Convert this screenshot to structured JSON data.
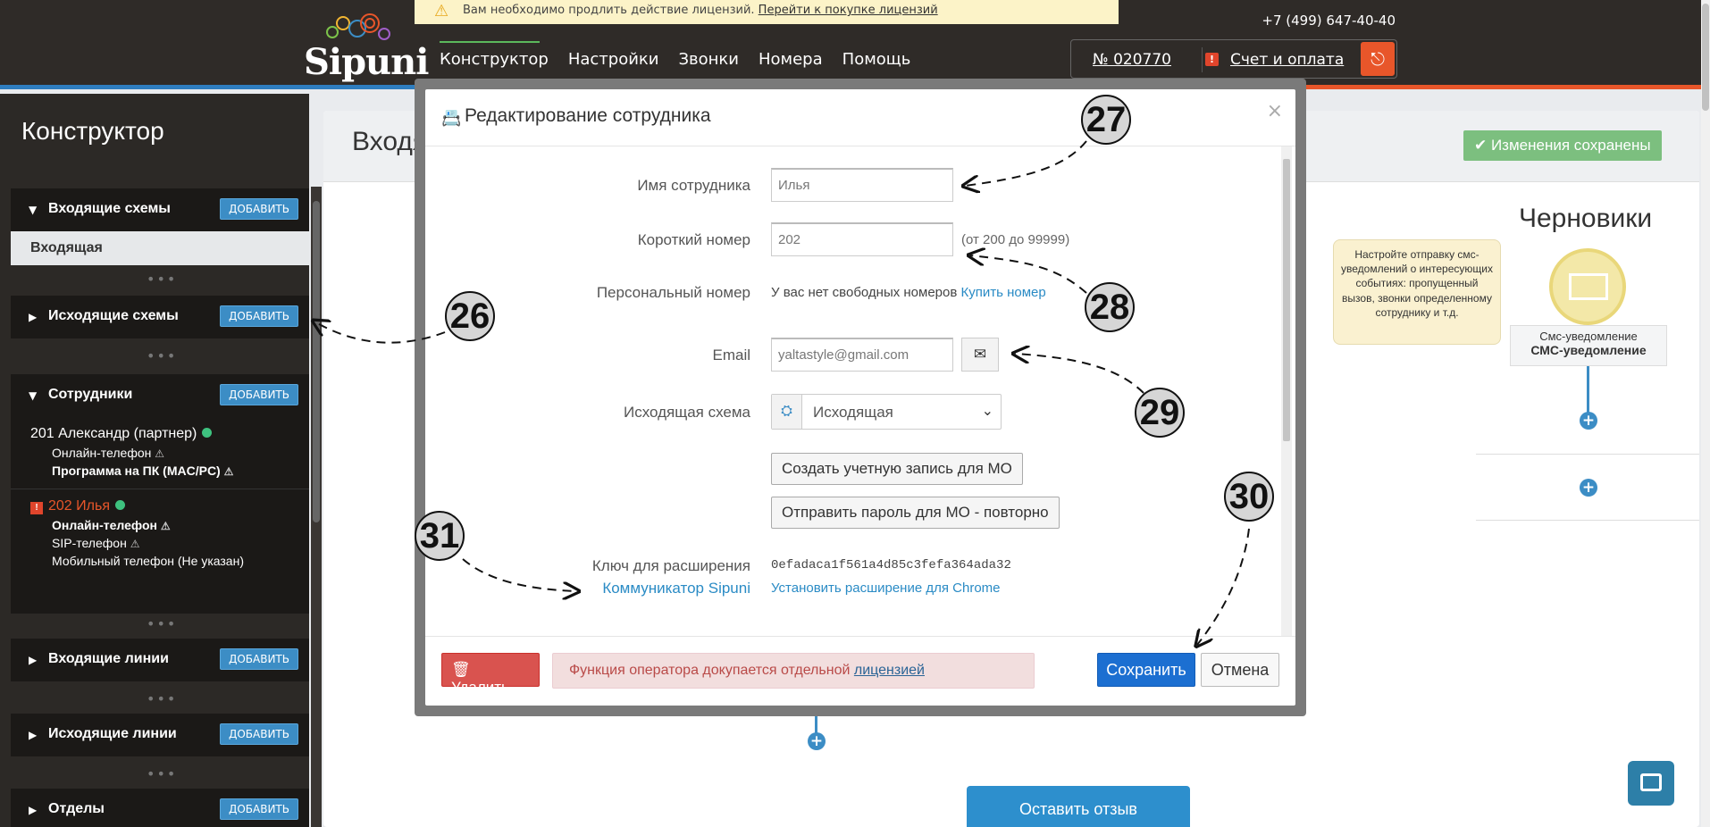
{
  "header": {
    "warning_text": "Вам необходимо продлить действие лицензий.",
    "warning_link": "Перейти к покупке лицензий",
    "logo_text": "Sipuni",
    "nav": [
      "Конструктор",
      "Настройки",
      "Звонки",
      "Номера",
      "Помощь"
    ],
    "phone": "+7 (499) 647-40-40",
    "account_number": "№ 020770",
    "alert_mark": "!",
    "billing": "Счет и оплата",
    "logout_icon": "logout-icon"
  },
  "sidebar": {
    "title": "Конструктор",
    "add_label": "ДОБАВИТЬ",
    "sections": {
      "incoming_schemes": "Входящие схемы",
      "incoming_item": "Входящая",
      "outgoing_schemes": "Исходящие схемы",
      "employees": "Сотрудники",
      "incoming_lines": "Входящие линии",
      "outgoing_lines": "Исходящие линии",
      "departments": "Отделы"
    },
    "employee1": {
      "name": "201 Александр (партнер)",
      "sub1": "Онлайн-телефон",
      "sub2": "Программа на ПК (MAC/PC)"
    },
    "employee2": {
      "name": "202 Илья",
      "sub1": "Онлайн-телефон",
      "sub2": "SIP-телефон",
      "sub3": "Мобильный телефон (Не указан)"
    },
    "dots": "•••"
  },
  "main": {
    "title": "Входя",
    "saved_badge": "✔ Изменения сохранены",
    "drafts_title": "Черновики",
    "tip_text": "Настройте отправку смс-уведомлений о интересующих событиях: пропущенный вызов, звонки определенному сотруднику и т.д.",
    "sms_card_small": "Смс-уведомление",
    "sms_card_bold": "СМС-уведомление",
    "feedback_button": "Оставить отзыв"
  },
  "modal": {
    "title": "Редактирование сотрудника",
    "close": "×",
    "fields": {
      "name_label": "Имя сотрудника",
      "name_value": "Илья",
      "short_label": "Короткий номер",
      "short_value": "202",
      "short_hint": "(от 200 до 99999)",
      "personal_label": "Персональный номер",
      "personal_text": "У вас нет свободных номеров",
      "personal_link": "Купить номер",
      "email_label": "Email",
      "email_value": "yaltastyle@gmail.com",
      "scheme_label": "Исходящая схема",
      "scheme_value": "Исходящая",
      "create_mo_button": "Создать учетную запись для МО",
      "send_pw_button": "Отправить пароль для МО - повторно",
      "key_label": "Ключ для расширения",
      "key_value": "0efadaca1f561a4d85c3fefa364ada32",
      "communicator_link": "Коммуникатор Sipuni",
      "install_link": "Установить расширение для Chrome"
    },
    "footer": {
      "delete": "Удалить",
      "alert_text": "Функция оператора докупается отдельной",
      "alert_link": "лицензией",
      "save": "Сохранить",
      "cancel": "Отмена"
    }
  },
  "callouts": [
    "26",
    "27",
    "28",
    "29",
    "30",
    "31"
  ],
  "colors": {
    "accent_blue": "#3c8dc5",
    "accent_orange": "#e8562a",
    "header_bg": "#2f2b28",
    "save_blue": "#1c6fd1",
    "delete_red": "#d9534f"
  }
}
